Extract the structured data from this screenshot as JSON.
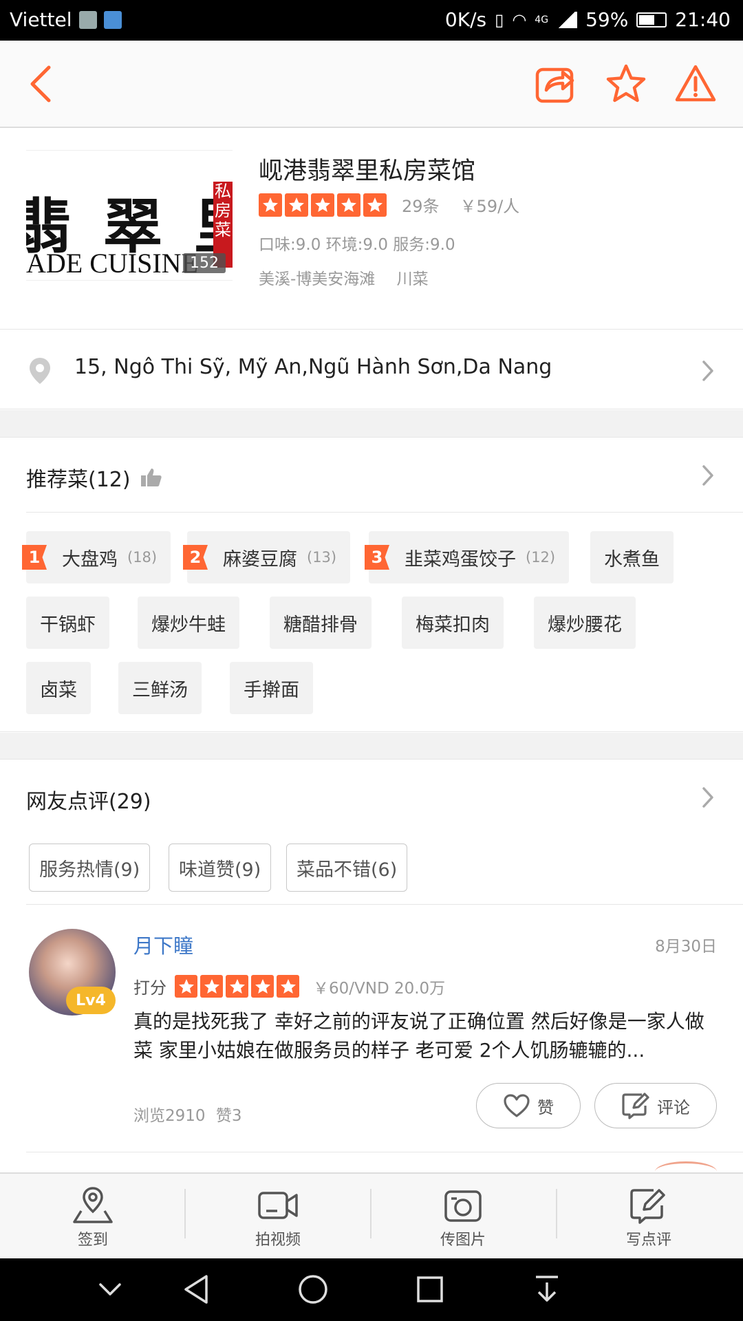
{
  "status_bar": {
    "carrier": "Viettel",
    "speed": "0K/s",
    "network": "4G",
    "battery": "59%",
    "time": "21:40"
  },
  "shop": {
    "name": "岘港翡翠里私房菜馆",
    "image_calligraphy": "翡 翠 里",
    "image_english": "ADE CUISINE",
    "image_seal": "私房菜",
    "photo_count": "152",
    "rating_stars": 5,
    "review_count": "29条",
    "price": "￥59/人",
    "scores": "口味:9.0 环境:9.0 服务:9.0",
    "area": "美溪-博美安海滩",
    "cuisine": "川菜"
  },
  "address": {
    "text": "15, Ngô Thi Sỹ, Mỹ An,Ngũ Hành Sơn,Da Nang"
  },
  "recommended": {
    "title": "推荐菜(12)",
    "dishes": [
      {
        "rank": "1",
        "name": "大盘鸡",
        "count": "(18)"
      },
      {
        "rank": "2",
        "name": "麻婆豆腐",
        "count": "(13)"
      },
      {
        "rank": "3",
        "name": "韭菜鸡蛋饺子",
        "count": "(12)"
      },
      {
        "name": "水煮鱼"
      },
      {
        "name": "干锅虾"
      },
      {
        "name": "爆炒牛蛙"
      },
      {
        "name": "糖醋排骨"
      },
      {
        "name": "梅菜扣肉"
      },
      {
        "name": "爆炒腰花"
      },
      {
        "name": "卤菜"
      },
      {
        "name": "三鲜汤"
      },
      {
        "name": "手擀面"
      }
    ]
  },
  "reviews": {
    "title": "网友点评(29)",
    "tags": [
      "服务热情(9)",
      "味道赞(9)",
      "菜品不错(6)"
    ],
    "items": [
      {
        "user": "月下瞳",
        "level": "Lv4",
        "date": "8月30日",
        "score_label": "打分",
        "stars": 5,
        "price": "￥60/VND 20.0万",
        "text": "真的是找死我了 幸好之前的评友说了正确位置 然后好像是一家人做菜 家里小姑娘在做服务员的样子 老可爱 2个人饥肠辘辘的...",
        "views": "浏览2910",
        "likes": "赞3",
        "like_label": "赞",
        "comment_label": "评论"
      }
    ]
  },
  "action_bar": {
    "items": [
      {
        "label": "签到",
        "icon": "checkin-pin-icon"
      },
      {
        "label": "拍视频",
        "icon": "video-camera-icon"
      },
      {
        "label": "传图片",
        "icon": "photo-camera-icon"
      },
      {
        "label": "写点评",
        "icon": "write-review-icon"
      }
    ]
  },
  "colors": {
    "accent": "#ff6633",
    "link": "#3e78c8",
    "level_badge": "#f5b72a"
  }
}
